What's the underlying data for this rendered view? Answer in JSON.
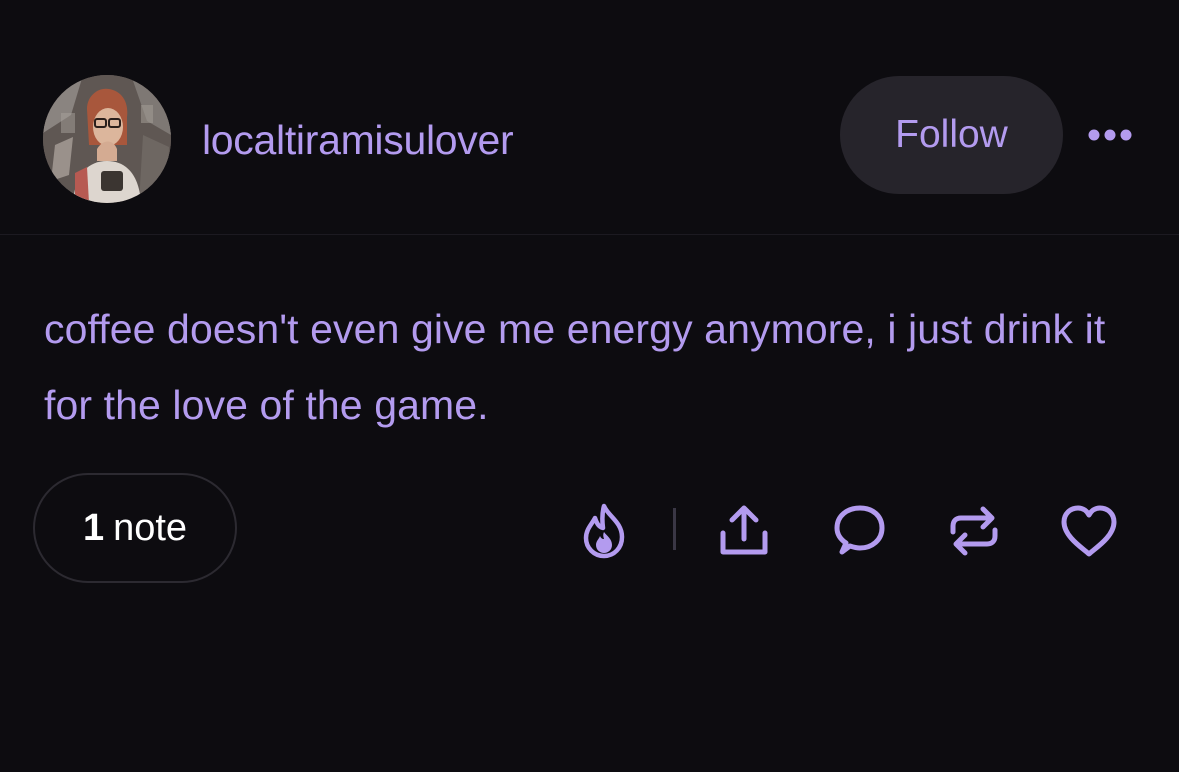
{
  "post": {
    "username": "localtiramisulover",
    "follow_label": "Follow",
    "more_icon": "more-dots-icon",
    "text": "coffee doesn't even give me energy anymore, i just drink it for the love of the game.",
    "notes_count": "1",
    "notes_label": "note"
  },
  "actions": [
    {
      "name": "blaze",
      "icon": "flame-icon"
    },
    {
      "name": "share",
      "icon": "share-upload-icon"
    },
    {
      "name": "reply",
      "icon": "comment-bubble-icon"
    },
    {
      "name": "reblog",
      "icon": "reblog-arrows-icon"
    },
    {
      "name": "like",
      "icon": "heart-icon"
    }
  ],
  "colors": {
    "background": "#0d0c10",
    "accent": "#b39bef",
    "button_bg": "#26242b",
    "notes_text": "#ffffff"
  }
}
